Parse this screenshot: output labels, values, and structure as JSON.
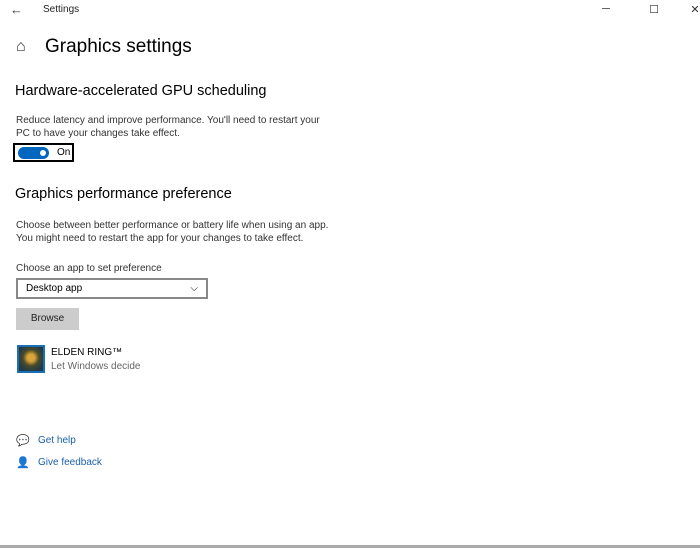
{
  "window": {
    "title": "Settings",
    "back_icon": "arrow-left-icon",
    "minimize": "─",
    "maximize": "☐",
    "close": "✕"
  },
  "page": {
    "title": "Graphics settings",
    "home_icon": "home-icon"
  },
  "gpu": {
    "heading": "Hardware-accelerated GPU scheduling",
    "description_line1": "Reduce latency and improve performance. You'll need to restart your",
    "description_line2": "PC to have your changes take effect.",
    "toggle_label": "On",
    "toggle_on": true,
    "accent": "#0067c0"
  },
  "perf": {
    "heading": "Graphics performance preference",
    "description_line1": "Choose between better performance or battery life when using an app.",
    "description_line2": "You might need to restart the app for your changes to take effect.",
    "select_label": "Choose an app to set preference",
    "select_value": "Desktop app",
    "browse_label": "Browse"
  },
  "apps": [
    {
      "name": "ELDEN RING™",
      "preference": "Let Windows decide"
    }
  ],
  "links": {
    "help": "Get help",
    "feedback": "Give feedback"
  }
}
